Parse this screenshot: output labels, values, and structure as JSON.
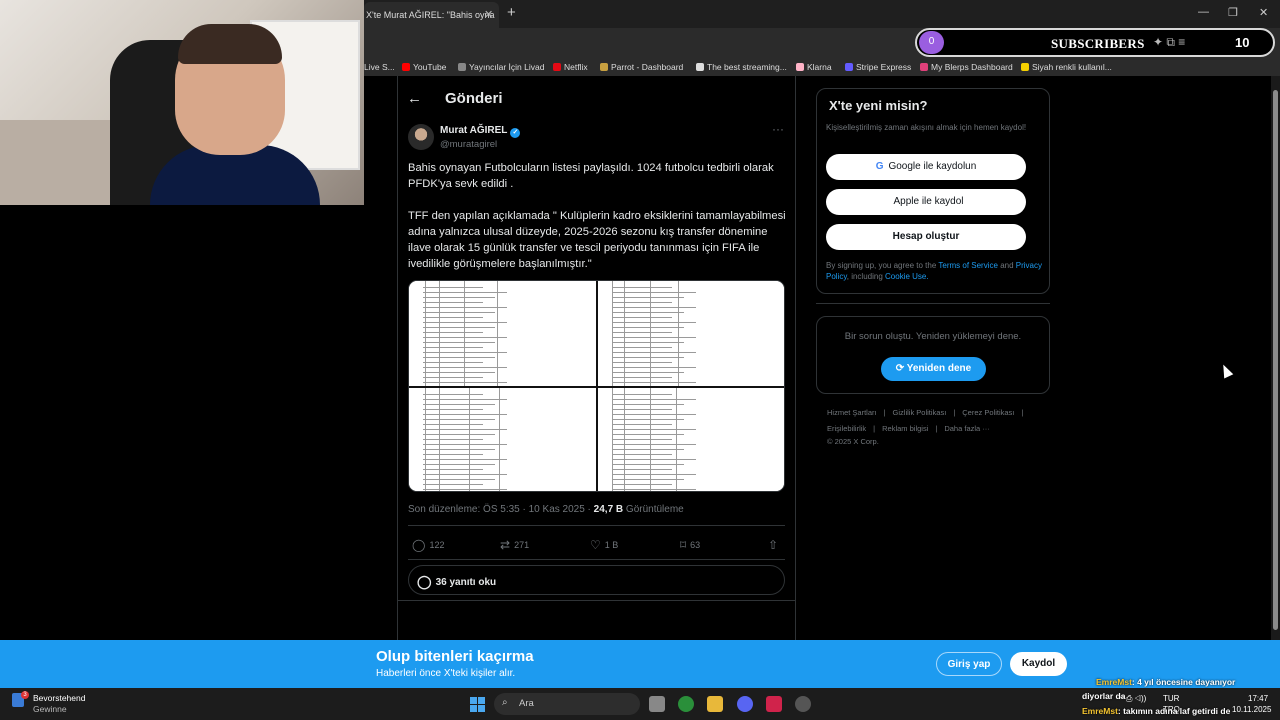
{
  "browser": {
    "tab_title": "X'te Murat AĞIREL: \"Bahis oyna",
    "tab_close": "✕",
    "new_tab": "+",
    "window_controls": [
      "—",
      "❐",
      "✕"
    ],
    "bookmarks": [
      {
        "label": "Live S...",
        "color": "#555555"
      },
      {
        "label": "YouTube",
        "color": "#ff0000"
      },
      {
        "label": "Yayıncılar İçin Livad",
        "color": "#888888"
      },
      {
        "label": "Netflix",
        "color": "#e50914"
      },
      {
        "label": "Parrot - Dashboard",
        "color": "#c8a040"
      },
      {
        "label": "The best streaming...",
        "color": "#dddddd"
      },
      {
        "label": "Klarna",
        "color": "#ffb3c7"
      },
      {
        "label": "Stripe Express",
        "color": "#635bff"
      },
      {
        "label": "My Blerps Dashboard",
        "color": "#e0407a"
      },
      {
        "label": "Siyah renkli kullanıl...",
        "color": "#f5d000"
      }
    ]
  },
  "overlay": {
    "subs_left_value": "0",
    "subs_label": "SUBSCRIBERS",
    "subs_icons": "✦   ⧉     ≡",
    "subs_count": "10"
  },
  "post": {
    "header_back": "←",
    "header_title": "Gönderi",
    "author_name": "Murat AĞIREL",
    "verified_mark": "✓",
    "handle": "@muratagirel",
    "more": "···",
    "text_p1": "Bahis oynayan Futbolcuların listesi paylaşıldı. 1024 futbolcu tedbirli olarak PFDK'ya sevk edildi .",
    "text_p2": "TFF den yapılan açıklamada \" Kulüplerin kadro eksiklerini tamamlayabilmesi adına yalnızca ulusal düzeyde, 2025-2026 sezonu kış transfer dönemine ilave olarak 15 günlük transfer ve tescil periyodu tanınması için FIFA ile ivedilikle görüşmelere başlanılmıştır.\"",
    "edited_label": "Son düzenleme: ÖS 5:35 · 10 Kas 2025 ·",
    "views_count": "24,7 B",
    "views_label": "Görüntüleme",
    "actions": [
      {
        "icon": "reply-icon",
        "glyph": "◯",
        "count": "122"
      },
      {
        "icon": "repost-icon",
        "glyph": "⇄",
        "count": "271"
      },
      {
        "icon": "like-icon",
        "glyph": "♡",
        "count": "1 B"
      },
      {
        "icon": "bookmark-icon",
        "glyph": "⌑",
        "count": "63"
      },
      {
        "icon": "share-icon",
        "glyph": "⇧",
        "count": ""
      }
    ],
    "replies_glyph": "◯",
    "replies_label": "36 yanıtı oku"
  },
  "sidebar": {
    "signup_title": "X'te yeni misin?",
    "signup_subtitle": "Kişiselleştirilmiş zaman akışını almak için hemen kaydol!",
    "google_glyph": "G",
    "google_label": "Google ile kaydolun",
    "apple_glyph": "",
    "apple_label": "Apple ile kaydol",
    "create_label": "Hesap oluştur",
    "terms_prefix": "By signing up, you agree to the",
    "terms_link": "Terms of Service",
    "terms_and": "and",
    "privacy_link": "Privacy Policy",
    "terms_including": ", including",
    "cookie_link": "Cookie Use.",
    "error_text": "Bir sorun oluştu. Yeniden yüklemeyi dene.",
    "retry_label": "⟳ Yeniden dene",
    "footer_row1": [
      "Hizmet Şartları",
      "|",
      "Gizlilik Politikası",
      "|",
      "Çerez Politikası",
      "|"
    ],
    "footer_row2": [
      "Erişilebilirlik",
      "|",
      "Reklam bilgisi",
      "|",
      "Daha fazla ···"
    ],
    "copyright": "© 2025 X Corp."
  },
  "banner": {
    "title": "Olup bitenleri kaçırma",
    "subtitle": "Haberleri önce X'teki kişiler alır.",
    "login_label": "Giriş yap",
    "signup_label": "Kaydol"
  },
  "chat": [
    {
      "user": "EmreMst",
      "message": ": 4 yıl öncesine dayanıyor"
    },
    {
      "user": "",
      "message": "diyorlar da"
    },
    {
      "user": "EmreMst",
      "message": ": takımın adına laf getirdi de"
    }
  ],
  "taskbar": {
    "weather_line1": "Bevorstehend",
    "weather_line2": "Gewinne",
    "weather_badge": "3",
    "search_placeholder": "Ara",
    "search_glyph": "⌕",
    "lang": "TUR",
    "lang2": "TRQ",
    "time": "17:47",
    "date": "10.11.2025",
    "tray_icons": "^  ⎙  ◁))"
  }
}
